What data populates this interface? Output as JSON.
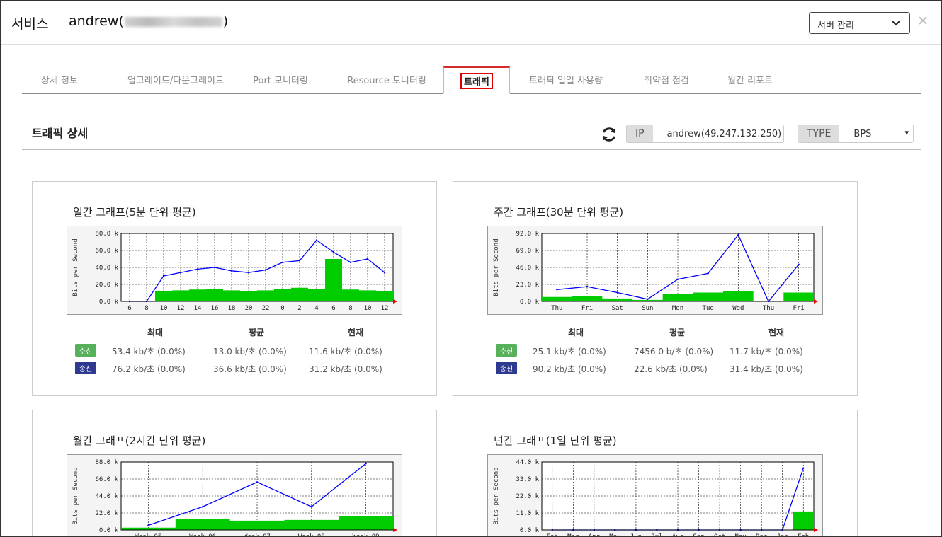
{
  "header": {
    "title": "서비스",
    "user_prefix": "andrew(",
    "user_suffix": ")",
    "service_select": "서버 관리",
    "close_glyph": "✕"
  },
  "tabs": [
    {
      "label": "상세 정보",
      "active": false
    },
    {
      "label": "업그레이드/다운그레이드",
      "active": false
    },
    {
      "label": "Port 모니터링",
      "active": false
    },
    {
      "label": "Resource 모니터링",
      "active": false
    },
    {
      "label": "트래픽",
      "active": true
    },
    {
      "label": "트래픽 일일 사용량",
      "active": false
    },
    {
      "label": "취약점 점검",
      "active": false
    },
    {
      "label": "월간 리포트",
      "active": false
    }
  ],
  "section": {
    "title": "트래픽 상세",
    "ip_label": "IP",
    "ip_value": "andrew(49.247.132.250)",
    "type_label": "TYPE",
    "type_value": "BPS"
  },
  "stats_headers": {
    "max": "최대",
    "avg": "평균",
    "cur": "현재"
  },
  "badges": {
    "rx": "수신",
    "tx": "송신"
  },
  "colors": {
    "rx": "#00cc00",
    "tx": "#0000ff",
    "active_tab": "#d52b2b"
  },
  "y_axis_label": "Bits per Second",
  "panels": [
    {
      "title": "일간 그래프(5분 단위 평균)",
      "stats": {
        "rx": {
          "max": "53.4 kb/초 (0.0%)",
          "avg": "13.0 kb/초 (0.0%)",
          "cur": "11.6 kb/초 (0.0%)"
        },
        "tx": {
          "max": "76.2 kb/초 (0.0%)",
          "avg": "36.6 kb/초 (0.0%)",
          "cur": "31.2 kb/초 (0.0%)"
        }
      }
    },
    {
      "title": "주간 그래프(30분 단위 평균)",
      "stats": {
        "rx": {
          "max": "25.1 kb/초 (0.0%)",
          "avg": "7456.0 b/초 (0.0%)",
          "cur": "11.7 kb/초 (0.0%)"
        },
        "tx": {
          "max": "90.2 kb/초 (0.0%)",
          "avg": "22.6 kb/초 (0.0%)",
          "cur": "31.4 kb/초 (0.0%)"
        }
      }
    },
    {
      "title": "월간 그래프(2시간 단위 평균)"
    },
    {
      "title": "년간 그래프(1일 단위 평균)"
    }
  ],
  "chart_data": [
    {
      "type": "area",
      "title": "일간 그래프(5분 단위 평균)",
      "ylabel": "Bits per Second",
      "yticks": [
        "0.0 k",
        "20.0 k",
        "40.0 k",
        "60.0 k",
        "80.0 k"
      ],
      "ylim": [
        0,
        80000
      ],
      "categories": [
        "6",
        "8",
        "10",
        "12",
        "14",
        "16",
        "18",
        "20",
        "22",
        "0",
        "2",
        "4",
        "6",
        "8",
        "10",
        "12"
      ],
      "series": [
        {
          "name": "수신",
          "values": [
            0,
            0,
            12000,
            13000,
            14000,
            15000,
            13000,
            12000,
            13000,
            15000,
            16000,
            15000,
            50000,
            14000,
            13000,
            12000
          ]
        },
        {
          "name": "송신",
          "values": [
            0,
            0,
            30000,
            34000,
            38000,
            40000,
            36000,
            34000,
            37000,
            46000,
            48000,
            72000,
            58000,
            46000,
            50000,
            34000
          ]
        }
      ]
    },
    {
      "type": "area",
      "title": "주간 그래프(30분 단위 평균)",
      "ylabel": "Bits per Second",
      "yticks": [
        "0.0 k",
        "23.0 k",
        "46.0 k",
        "69.0 k",
        "92.0 k"
      ],
      "ylim": [
        0,
        92000
      ],
      "categories": [
        "Thu",
        "Fri",
        "Sat",
        "Sun",
        "Mon",
        "Tue",
        "Wed",
        "Thu",
        "Fri"
      ],
      "series": [
        {
          "name": "수신",
          "values": [
            6000,
            7000,
            4000,
            2000,
            10000,
            12000,
            14000,
            0,
            12000
          ]
        },
        {
          "name": "송신",
          "values": [
            16000,
            20000,
            12000,
            3000,
            30000,
            38000,
            90000,
            0,
            50000
          ]
        }
      ]
    },
    {
      "type": "area",
      "title": "월간 그래프(2시간 단위 평균)",
      "ylabel": "Bits per Second",
      "yticks": [
        "0.0 k",
        "22.0 k",
        "44.0 k",
        "66.0 k",
        "88.0 k"
      ],
      "ylim": [
        0,
        88000
      ],
      "categories": [
        "Week 05",
        "Week 06",
        "Week 07",
        "Week 08",
        "Week 09"
      ],
      "series": [
        {
          "name": "수신",
          "values": [
            3000,
            14000,
            12000,
            13000,
            18000
          ]
        },
        {
          "name": "송신",
          "values": [
            6000,
            30000,
            62000,
            30000,
            86000
          ]
        }
      ]
    },
    {
      "type": "area",
      "title": "년간 그래프(1일 단위 평균)",
      "ylabel": "Bits per Second",
      "yticks": [
        "0.0 k",
        "11.0 k",
        "22.0 k",
        "33.0 k",
        "44.0 k"
      ],
      "ylim": [
        0,
        44000
      ],
      "categories": [
        "Feb",
        "Mar",
        "Apr",
        "May",
        "Jun",
        "Jul",
        "Aug",
        "Sep",
        "Oct",
        "Nov",
        "Dec",
        "Jan",
        "Feb"
      ],
      "series": [
        {
          "name": "수신",
          "values": [
            0,
            0,
            0,
            0,
            0,
            0,
            0,
            0,
            0,
            0,
            0,
            0,
            12000
          ]
        },
        {
          "name": "송신",
          "values": [
            0,
            0,
            0,
            0,
            0,
            0,
            0,
            0,
            0,
            0,
            0,
            0,
            40000
          ]
        }
      ]
    }
  ]
}
